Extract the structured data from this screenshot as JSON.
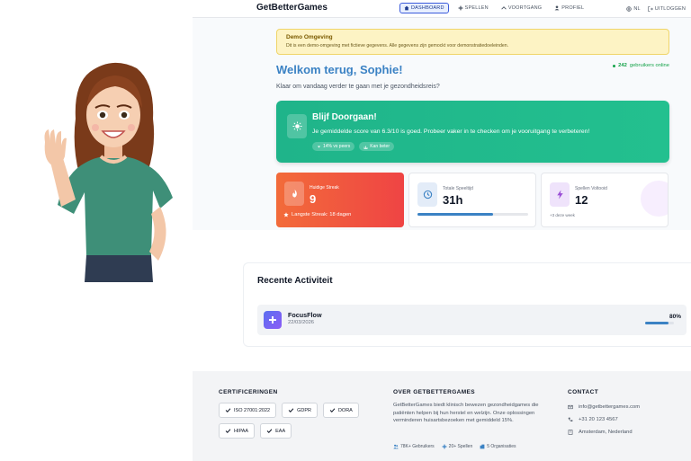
{
  "header": {
    "brand": "GetBetterGames",
    "nav": [
      {
        "label": "DASHBOARD",
        "icon": "home-icon"
      },
      {
        "label": "SPELLEN",
        "icon": "gamepad-icon"
      },
      {
        "label": "VOORTGANG",
        "icon": "trend-icon"
      },
      {
        "label": "PROFIEL",
        "icon": "user-icon"
      }
    ],
    "language": "NL",
    "logout": "UITLOGGEN"
  },
  "demo": {
    "title": "Demo Omgeving",
    "text": "Dit is een demo-omgeving met fictieve gegevens. Alle gegevens zijn gemockt voor demonstratiedoeleinden."
  },
  "welcome": {
    "title": "Welkom terug, Sophie!",
    "subtitle": "Klaar om vandaag verder te gaan met je gezondheidsreis?",
    "online_count": "242",
    "online_label": "gebruikers online"
  },
  "motivation": {
    "title": "Blijf Doorgaan!",
    "text": "Je gemiddelde score van 6.3/10 is goed. Probeer vaker in te checken om je vooruitgang te verbeteren!",
    "badges": [
      "14% vs peers",
      "Kan beter"
    ]
  },
  "stats": {
    "streak": {
      "label": "Huidige Streak",
      "value": "9",
      "foot": "Langste Streak: 18 dagen"
    },
    "playtime": {
      "label": "Totale Speeltijd",
      "value": "31h",
      "progress": 0.68
    },
    "games": {
      "label": "Spellen Voltooid",
      "value": "12",
      "foot": "+3 deze week"
    }
  },
  "recent": {
    "title": "Recente Activiteit",
    "items": [
      {
        "name": "FocusFlow",
        "date": "22/03/2026",
        "percent": "80%",
        "progress": 0.8
      }
    ]
  },
  "footer": {
    "cert_title": "CERTIFICERINGEN",
    "certs": [
      "ISO 27001:2022",
      "GDPR",
      "DORA",
      "HIPAA",
      "EAA"
    ],
    "about_title": "OVER GETBETTERGAMES",
    "about_text": "GetBetterGames biedt klinisch bewezen gezondheidgames die patiënten helpen bij hun herstel en welzijn. Onze oplossingen verminderen huisartsbezoeken met gemiddeld 15%.",
    "about_stats": [
      "78K+ Gebruikers",
      "20+ Spellen",
      "5 Organisaties"
    ],
    "contact_title": "CONTACT",
    "contact": {
      "email": "info@getbettergames.com",
      "phone": "+31 20 123 4567",
      "address": "Amsterdam, Nederland"
    }
  },
  "colors": {
    "accent": "#3b82c4",
    "success": "#1fb48a",
    "streak": "#ef4444"
  }
}
